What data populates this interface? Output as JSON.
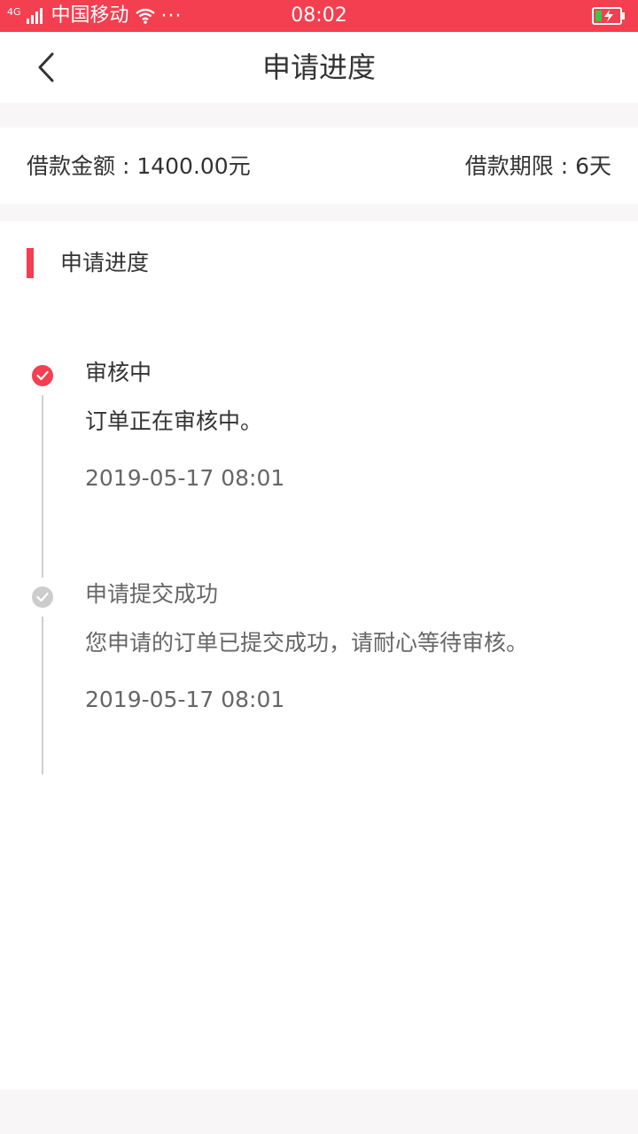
{
  "status_bar": {
    "network": "4G",
    "carrier": "中国移动",
    "more": "···",
    "time": "08:02",
    "bg_color": "#f33f4f"
  },
  "nav": {
    "title": "申请进度",
    "back_icon": "chevron-left-icon"
  },
  "loan": {
    "amount": "借款金额 : 1400.00元",
    "term": "借款期限 : 6天"
  },
  "section": {
    "title": "申请进度",
    "accent_color": "#f33f4f"
  },
  "timeline": [
    {
      "title": "审核中",
      "description": "订单正在审核中。",
      "time": "2019-05-17 08:01",
      "state": "active",
      "dot_color": "#f33f4f"
    },
    {
      "title": "申请提交成功",
      "description": "您申请的订单已提交成功，请耐心等待审核。",
      "time": "2019-05-17 08:01",
      "state": "done",
      "dot_color": "#cccccc"
    }
  ]
}
